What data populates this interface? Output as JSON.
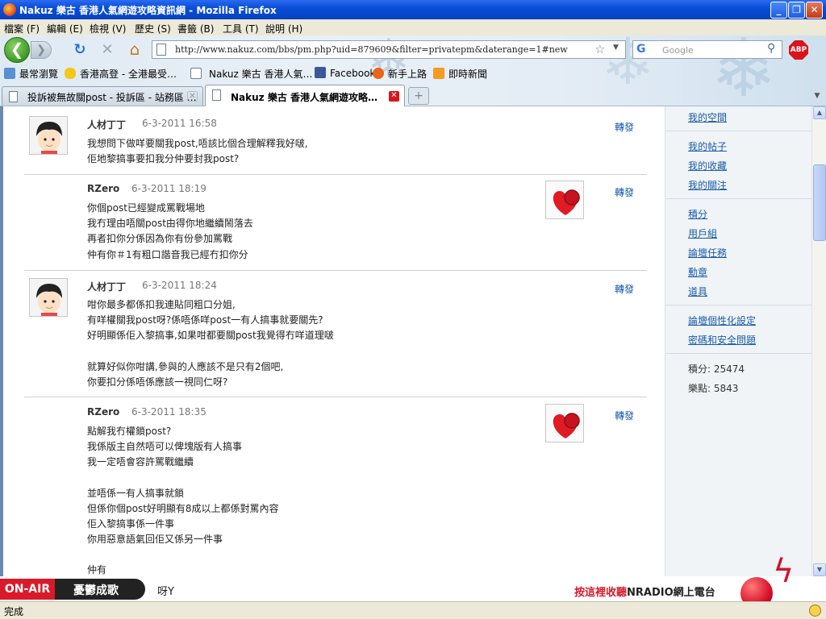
{
  "window": {
    "title": "Nakuz 樂古 香港人氣網遊攻略資訊網 - Mozilla Firefox",
    "min_label": "_",
    "max_label": "❐",
    "close_label": "✕"
  },
  "menu": [
    "檔案 (F)",
    "編輯 (E)",
    "檢視 (V)",
    "歷史 (S)",
    "書籤 (B)",
    "工具 (T)",
    "說明 (H)"
  ],
  "toolbar": {
    "back_glyph": "❮",
    "fwd_glyph": "❯",
    "reload_glyph": "↻",
    "stop_glyph": "✕",
    "home_glyph": "⌂",
    "url": "http://www.nakuz.com/bbs/pm.php?uid=879609&filter=privatepm&daterange=1#new",
    "search_placeholder": "Google",
    "abp_label": "ABP"
  },
  "bookmarks": [
    {
      "label": "最常瀏覽",
      "icon": "bookmark-folder-icon",
      "color": "#5a8fd0"
    },
    {
      "label": "香港高登 - 全港最受…",
      "icon": "hand-icon",
      "color": "#f6c61b"
    },
    {
      "label": "Nakuz 樂古 香港人氣…",
      "icon": "page-icon",
      "color": "#ffffff"
    },
    {
      "label": "Facebook",
      "icon": "facebook-icon",
      "color": "#3b5998"
    },
    {
      "label": "新手上路",
      "icon": "firefox-icon",
      "color": "#e8651a"
    },
    {
      "label": "即時新聞",
      "icon": "rss-icon",
      "color": "#f49b21"
    }
  ],
  "tabs": [
    {
      "label": "投訴被無故關post - 投訴區 - 站務區 …",
      "active": false
    },
    {
      "label": "Nakuz 樂古 香港人氣網遊攻略…",
      "active": true
    }
  ],
  "messages": [
    {
      "author": "人材丁丁",
      "date": "6-3-2011 16:58",
      "forward": "轉發",
      "lines": [
        "我想問下做咩要關我post,唔該比個合理解釋我好啵,",
        "佢地黎搞事要扣我分仲要封我post?"
      ]
    },
    {
      "author": "RZero",
      "date": "6-3-2011 18:19",
      "forward": "轉發",
      "lines": [
        "你個post已經變成罵戰場地",
        "我冇理由唔關post由得你地繼續鬧落去",
        "再者扣你分係因為你有份參加罵戰",
        "仲有你＃1有粗口諧音我已經冇扣你分"
      ]
    },
    {
      "author": "人材丁丁",
      "date": "6-3-2011 18:24",
      "forward": "轉發",
      "lines": [
        "咁你最多都係扣我連貼同粗口分姐,",
        "有咩權關我post呀?係唔係咩post一有人搞事就要關先?",
        "好明顯係佢入黎搞事,如果咁都要關post我覺得冇咩道理啵",
        "",
        "就算好似你咁講,參與的人應該不是只有2個吧,",
        "你要扣分係唔係應該一視同仁呀?"
      ]
    },
    {
      "author": "RZero",
      "date": "6-3-2011 18:35",
      "forward": "轉發",
      "lines": [
        "點解我冇權鎖post?",
        "我係版主自然唔可以俾塊版有人搞事",
        "我一定唔會容許罵戰繼續",
        "",
        "並唔係一有人搞事就鎖",
        "但係你個post好明顯有8成以上都係對罵內容",
        "佢入黎搞事係一件事",
        "你用惡意語氣回佢又係另一件事",
        "",
        "仲有"
      ]
    }
  ],
  "sidebar": {
    "links_group1": [
      "我的空間",
      "我的帖子",
      "我的收藏",
      "我的關注"
    ],
    "links_group2": [
      "積分",
      "用戶組",
      "論壇任務",
      "勳章",
      "道具"
    ],
    "links_group3": [
      "論壇個性化設定",
      "密碼和安全問題"
    ],
    "points": "積分: 25474",
    "coins": "樂點: 5843"
  },
  "radio": {
    "onair": "ON-AIR",
    "song": "憂鬱成歌",
    "show": "呀Y",
    "listen_prefix": "按這裡收聽",
    "listen_brand": "NRADIO網上電台"
  },
  "status": "完成",
  "colors": {
    "accent": "#1a5ba8",
    "onair_red": "#d81b2a",
    "titlebar": "#0a4fd8"
  }
}
